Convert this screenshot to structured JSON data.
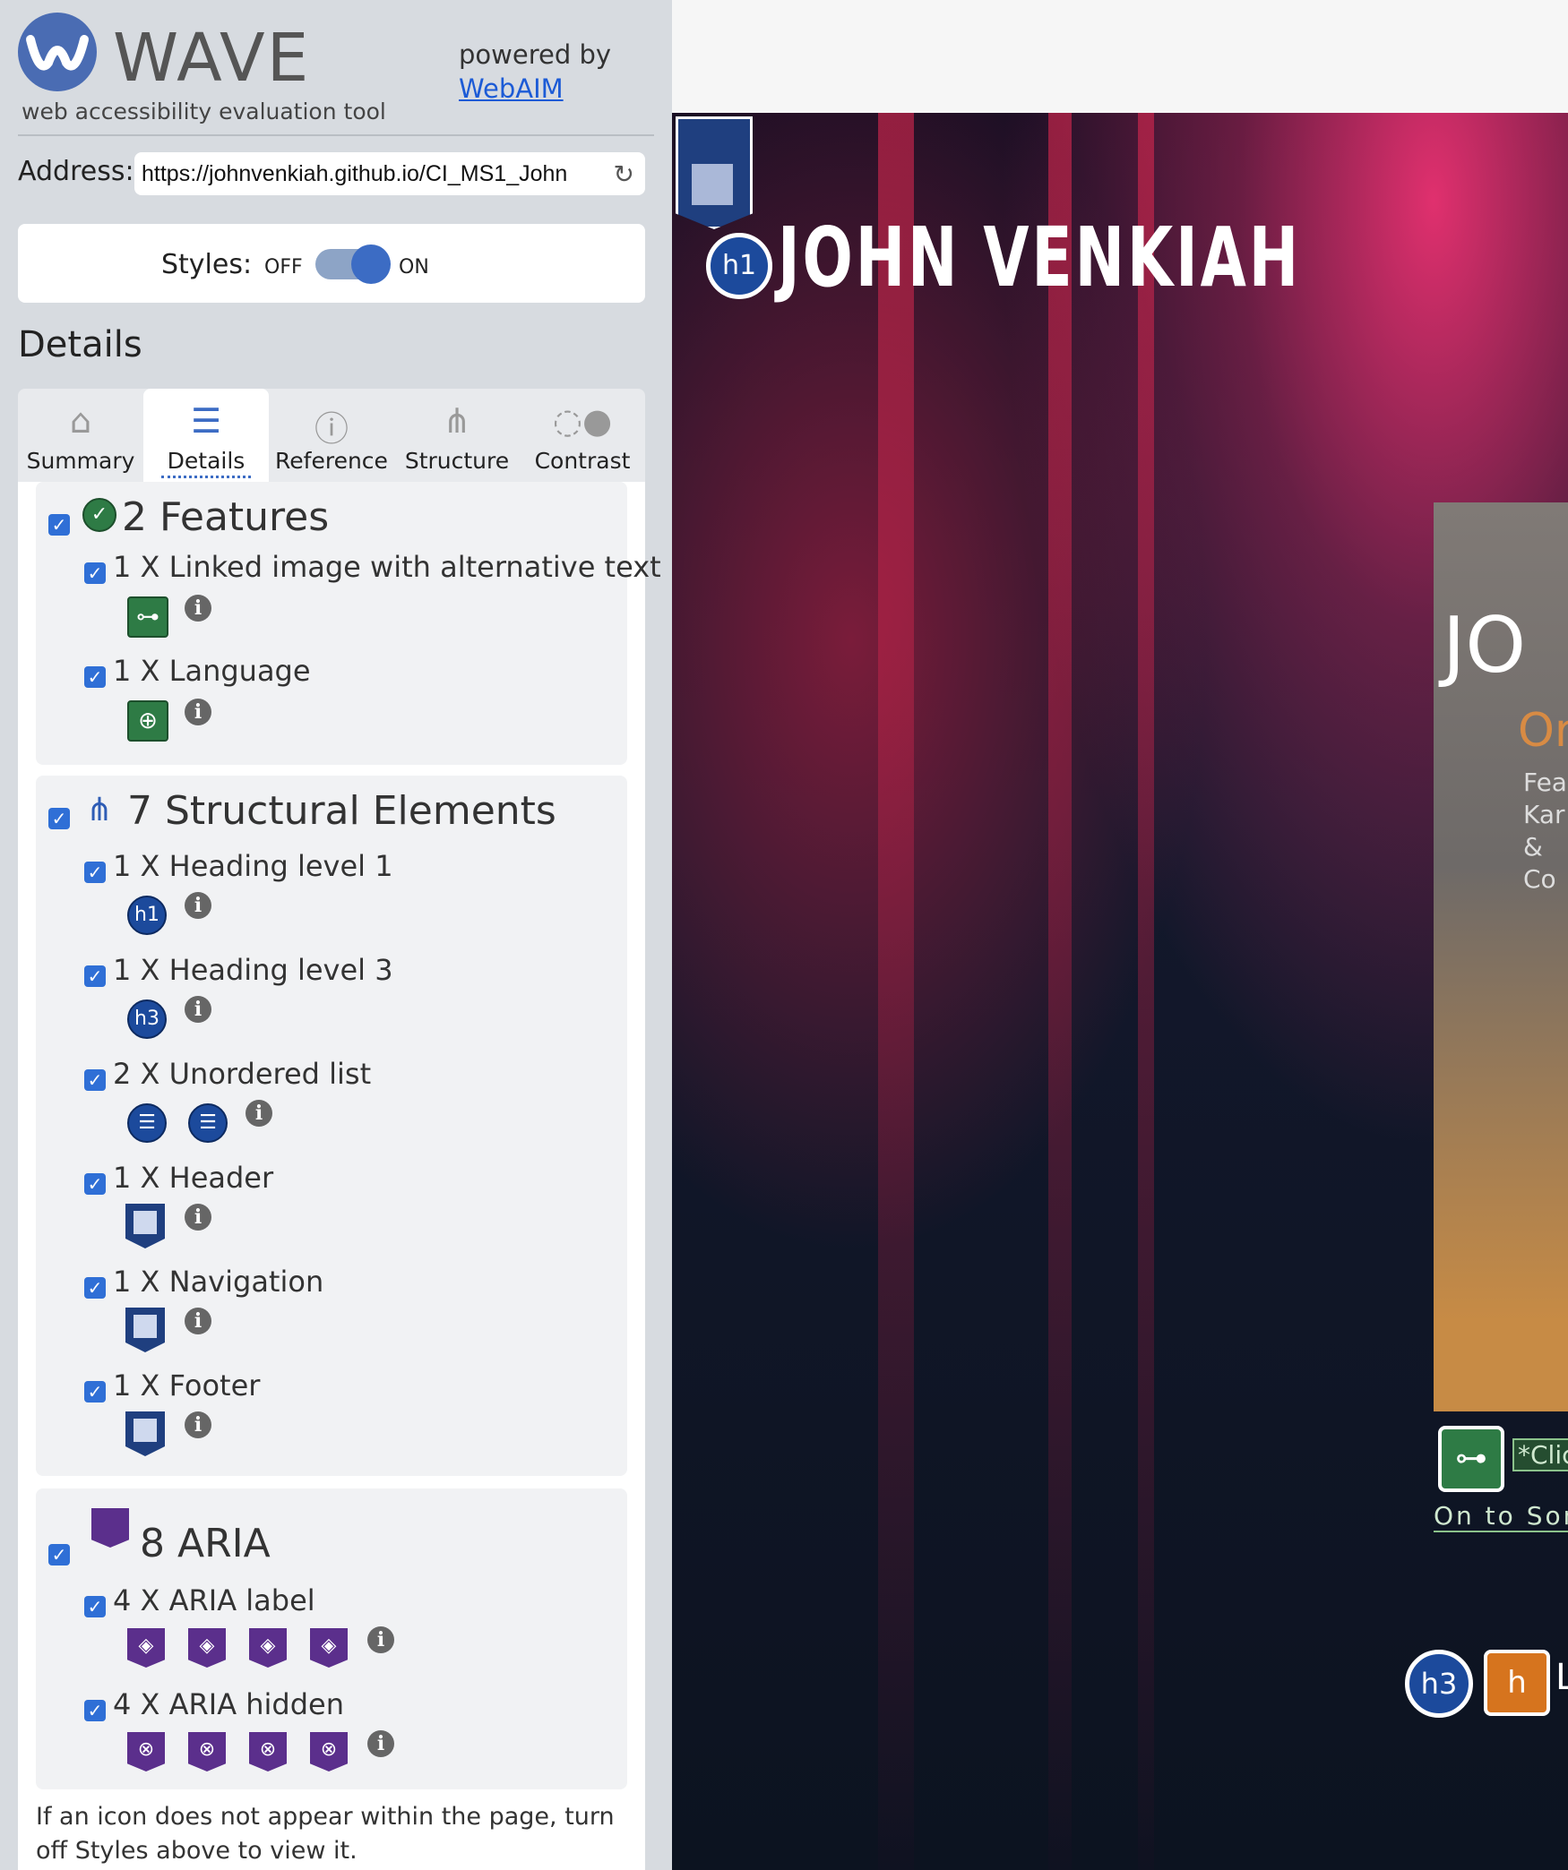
{
  "wave": {
    "logo_word": "WAVE",
    "logo_sub": "web accessibility evaluation tool",
    "powered_by": "powered by",
    "webaim_link": "WebAIM",
    "address_label": "Address:",
    "address_value": "https://johnvenkiah.github.io/CI_MS1_John",
    "styles_label": "Styles:",
    "styles_off": "OFF",
    "styles_on": "ON",
    "styles_enabled": true,
    "details_title": "Details"
  },
  "tabs": [
    {
      "label": "Summary",
      "icon": "home-icon"
    },
    {
      "label": "Details",
      "icon": "list-icon",
      "active": true
    },
    {
      "label": "Reference",
      "icon": "info-icon"
    },
    {
      "label": "Structure",
      "icon": "structure-icon"
    },
    {
      "label": "Contrast",
      "icon": "contrast-icon"
    }
  ],
  "features": {
    "title": "2 Features",
    "items": [
      {
        "label": "1 X Linked image with alternative text",
        "icon": "linked-image-icon"
      },
      {
        "label": "1 X Language",
        "icon": "language-icon"
      }
    ]
  },
  "structure": {
    "title": "7 Structural Elements",
    "items": [
      {
        "label": "1 X Heading level 1",
        "icon_text": "h1"
      },
      {
        "label": "1 X Heading level 3",
        "icon_text": "h3"
      },
      {
        "label": "2 X Unordered list",
        "icon": "unordered-list-icon"
      },
      {
        "label": "1 X Header",
        "icon": "header-icon"
      },
      {
        "label": "1 X Navigation",
        "icon": "navigation-icon"
      },
      {
        "label": "1 X Footer",
        "icon": "footer-icon"
      }
    ]
  },
  "aria": {
    "title": "8 ARIA",
    "items": [
      {
        "label": "4 X ARIA label",
        "icon": "aria-label-icon"
      },
      {
        "label": "4 X ARIA hidden",
        "icon": "aria-hidden-icon"
      }
    ]
  },
  "note": "If an icon does not appear within the page, turn off Styles above to view it.",
  "site": {
    "title": "JOHN VENKIAH",
    "h1_badge": "h1",
    "h3_badge": "h3",
    "card_jo": "JO",
    "card_or": "Or",
    "card_lines": [
      "Fea",
      "Kar",
      "& Co"
    ],
    "link_text": "*Clic",
    "onto_text": "On to Som",
    "orange_badge": "h",
    "trailing_letter": "L"
  },
  "colors": {
    "accent_blue": "#3c6cc4",
    "feature_green": "#2e7b45",
    "aria_purple": "#5b2f8c",
    "alert_orange": "#d6741e"
  }
}
